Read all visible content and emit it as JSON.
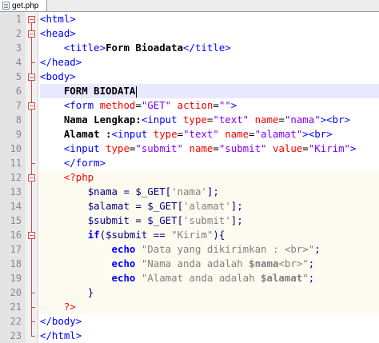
{
  "tab": {
    "title": "get.php",
    "icon": "php-file-icon"
  },
  "colors": {
    "tag": "#0000ff",
    "attribute": "#ff0000",
    "string": "#8000ff",
    "php_string": "#808080",
    "php_keyword": "#0000ff",
    "php_delimiter": "#ff0000",
    "gutter": "#e4e4e4",
    "current_line": "#e8e8ff"
  },
  "lines": [
    {
      "no": "1",
      "tokens": [
        [
          "t",
          "<html>"
        ]
      ]
    },
    {
      "no": "2",
      "tokens": [
        [
          "t",
          "<head>"
        ]
      ]
    },
    {
      "no": "3",
      "tokens": [
        [
          "n",
          "    "
        ],
        [
          "t",
          "<title>"
        ],
        [
          "b",
          "Form Bioadata"
        ],
        [
          "t",
          "</title>"
        ]
      ]
    },
    {
      "no": "4",
      "tokens": [
        [
          "t",
          "</head>"
        ]
      ]
    },
    {
      "no": "5",
      "tokens": [
        [
          "t",
          "<body>"
        ]
      ]
    },
    {
      "no": "6",
      "tokens": [
        [
          "n",
          "    "
        ],
        [
          "b",
          "FORM BIODATA"
        ]
      ]
    },
    {
      "no": "7",
      "tokens": [
        [
          "n",
          "    "
        ],
        [
          "t",
          "<form "
        ],
        [
          "a",
          "method"
        ],
        [
          "n",
          "="
        ],
        [
          "v",
          "\"GET\""
        ],
        [
          "n",
          " "
        ],
        [
          "a",
          "action"
        ],
        [
          "n",
          "="
        ],
        [
          "v",
          "\"\""
        ],
        [
          "t",
          ">"
        ]
      ]
    },
    {
      "no": "8",
      "tokens": [
        [
          "n",
          "    "
        ],
        [
          "b",
          "Nama Lengkap:"
        ],
        [
          "t",
          "<input "
        ],
        [
          "a",
          "type"
        ],
        [
          "n",
          "="
        ],
        [
          "v",
          "\"text\""
        ],
        [
          "n",
          " "
        ],
        [
          "a",
          "name"
        ],
        [
          "n",
          "="
        ],
        [
          "v",
          "\"nama\""
        ],
        [
          "t",
          "><br>"
        ]
      ]
    },
    {
      "no": "9",
      "tokens": [
        [
          "n",
          "    "
        ],
        [
          "b",
          "Alamat :"
        ],
        [
          "t",
          "<input "
        ],
        [
          "a",
          "type"
        ],
        [
          "n",
          "="
        ],
        [
          "v",
          "\"text\""
        ],
        [
          "n",
          " "
        ],
        [
          "a",
          "name"
        ],
        [
          "n",
          "="
        ],
        [
          "v",
          "\"alamat\""
        ],
        [
          "t",
          "><br>"
        ]
      ]
    },
    {
      "no": "10",
      "tokens": [
        [
          "n",
          "    "
        ],
        [
          "t",
          "<input "
        ],
        [
          "a",
          "type"
        ],
        [
          "n",
          "="
        ],
        [
          "v",
          "\"submit\""
        ],
        [
          "n",
          " "
        ],
        [
          "a",
          "name"
        ],
        [
          "n",
          "="
        ],
        [
          "v",
          "\"submit\""
        ],
        [
          "n",
          " "
        ],
        [
          "a",
          "value"
        ],
        [
          "n",
          "="
        ],
        [
          "v",
          "\"Kirim\""
        ],
        [
          "t",
          ">"
        ]
      ]
    },
    {
      "no": "11",
      "tokens": [
        [
          "n",
          "    "
        ],
        [
          "t",
          "</form>"
        ]
      ]
    },
    {
      "no": "12",
      "tokens": [
        [
          "n",
          "    "
        ],
        [
          "p",
          "<?php"
        ]
      ]
    },
    {
      "no": "13",
      "tokens": [
        [
          "n",
          "        "
        ],
        [
          "o",
          "$nama = $_GET["
        ],
        [
          "s",
          "'nama'"
        ],
        [
          "o",
          "];"
        ]
      ]
    },
    {
      "no": "14",
      "tokens": [
        [
          "n",
          "        "
        ],
        [
          "o",
          "$alamat = $_GET["
        ],
        [
          "s",
          "'alamat'"
        ],
        [
          "o",
          "];"
        ]
      ]
    },
    {
      "no": "15",
      "tokens": [
        [
          "n",
          "        "
        ],
        [
          "o",
          "$submit = $_GET["
        ],
        [
          "s",
          "'submit'"
        ],
        [
          "o",
          "];"
        ]
      ]
    },
    {
      "no": "16",
      "tokens": [
        [
          "n",
          "        "
        ],
        [
          "kb",
          "if"
        ],
        [
          "o",
          "($submit == "
        ],
        [
          "s",
          "\"Kirim\""
        ],
        [
          "o",
          "){"
        ]
      ]
    },
    {
      "no": "17",
      "tokens": [
        [
          "n",
          "            "
        ],
        [
          "kb",
          "echo"
        ],
        [
          "n",
          " "
        ],
        [
          "s",
          "\"Data yang dikirimkan : <br>\""
        ],
        [
          "o",
          ";"
        ]
      ]
    },
    {
      "no": "18",
      "tokens": [
        [
          "n",
          "            "
        ],
        [
          "kb",
          "echo"
        ],
        [
          "n",
          " "
        ],
        [
          "s",
          "\"Nama anda adalah "
        ],
        [
          "sb",
          "$nama"
        ],
        [
          "s",
          "<br>\""
        ],
        [
          "o",
          ";"
        ]
      ]
    },
    {
      "no": "19",
      "tokens": [
        [
          "n",
          "            "
        ],
        [
          "kb",
          "echo"
        ],
        [
          "n",
          " "
        ],
        [
          "s",
          "\"Alamat anda adalah "
        ],
        [
          "sb",
          "$alamat"
        ],
        [
          "s",
          "\""
        ],
        [
          "o",
          ";"
        ]
      ]
    },
    {
      "no": "20",
      "tokens": [
        [
          "n",
          "        "
        ],
        [
          "o",
          "}"
        ]
      ]
    },
    {
      "no": "21",
      "tokens": [
        [
          "n",
          "    "
        ],
        [
          "p",
          "?>"
        ]
      ]
    },
    {
      "no": "22",
      "tokens": [
        [
          "t",
          "</body>"
        ]
      ]
    },
    {
      "no": "23",
      "tokens": [
        [
          "t",
          "</html>"
        ]
      ]
    }
  ]
}
